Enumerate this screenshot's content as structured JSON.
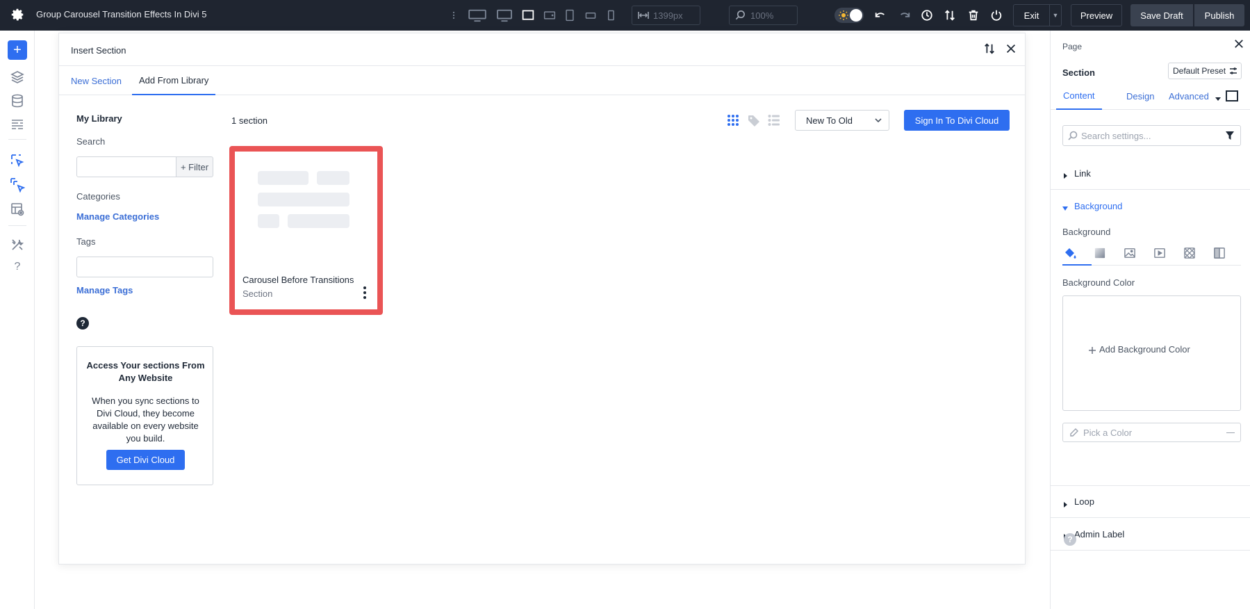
{
  "topbar": {
    "title": "Group Carousel Transition Effects In Divi 5",
    "width_value": "1399px",
    "zoom_value": "100%",
    "exit_label": "Exit",
    "preview_label": "Preview",
    "save_draft_label": "Save Draft",
    "publish_label": "Publish"
  },
  "modal": {
    "title": "Insert Section",
    "tabs": [
      {
        "label": "New Section",
        "active": false
      },
      {
        "label": "Add From Library",
        "active": true
      }
    ]
  },
  "library": {
    "heading": "My Library",
    "search_label": "Search",
    "filter_label": "+ Filter",
    "categories_label": "Categories",
    "manage_categories": "Manage Categories",
    "tags_label": "Tags",
    "manage_tags": "Manage Tags",
    "help_glyph": "?",
    "cloud_title": "Access Your sections From Any Website",
    "cloud_text": "When you sync sections to Divi Cloud, they become available on every website you build.",
    "cloud_button": "Get Divi Cloud",
    "count_label": "1 section",
    "sort_value": "New To Old",
    "signin_button": "Sign In To Divi Cloud",
    "items": [
      {
        "name": "Carousel Before Transitions",
        "type": "Section"
      }
    ]
  },
  "panel": {
    "page_label": "Page",
    "section_label": "Section",
    "preset_label": "Default Preset",
    "tabs": [
      "Content",
      "Design",
      "Advanced"
    ],
    "search_placeholder": "Search settings...",
    "accordions": {
      "link": "Link",
      "background": "Background",
      "loop": "Loop",
      "admin_label": "Admin Label"
    },
    "background_label": "Background",
    "background_color_label": "Background Color",
    "add_background_color": "Add Background Color",
    "pick_color": "Pick a Color"
  },
  "colors": {
    "accent": "#2e6ef0",
    "topbar": "#1f2530",
    "highlight": "#ea5455"
  }
}
